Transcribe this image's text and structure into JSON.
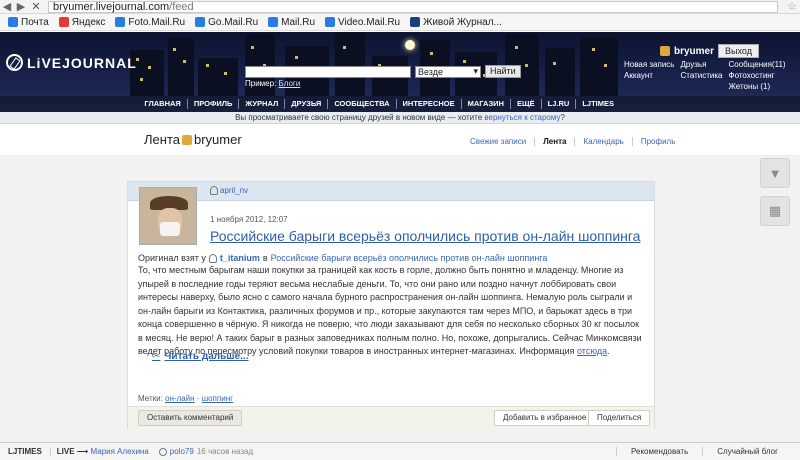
{
  "browser": {
    "url_host": "bryumer.livejournal.com",
    "url_path": "/feed",
    "bookmarks": [
      {
        "label": "Почта",
        "color": "#2a7be3"
      },
      {
        "label": "Яндекс",
        "color": "#e43a2f"
      },
      {
        "label": "Foto.Mail.Ru",
        "color": "#2a7be3"
      },
      {
        "label": "Go.Mail.Ru",
        "color": "#2a7be3"
      },
      {
        "label": "Mail.Ru",
        "color": "#2a7be3"
      },
      {
        "label": "Video.Mail.Ru",
        "color": "#2a7be3"
      },
      {
        "label": "Живой Журнал...",
        "color": "#1a3f7a"
      }
    ]
  },
  "header": {
    "logo_text": "LiVEJOURNAL",
    "search": {
      "scope": "Везде",
      "button": "Найти",
      "example_label": "Пример:",
      "example_link": "Блоги"
    },
    "user": {
      "name": "bryumer",
      "logout": "Выход"
    },
    "user_links": [
      "Новая запись",
      "Друзья",
      "Сообщения(11)",
      "Аккаунт",
      "Статистика",
      "Фотохостинг",
      "",
      "",
      "Жетоны (1)"
    ],
    "nav": [
      "ГЛАВНАЯ",
      "ПРОФИЛЬ",
      "ЖУРНАЛ",
      "ДРУЗЬЯ",
      "СООБЩЕСТВА",
      "ИНТЕРЕСНОЕ",
      "МАГАЗИН",
      "ЕЩЁ",
      "LJ.RU",
      "LJTIMES"
    ]
  },
  "notice": {
    "text": "Вы просматриваете свою страницу друзей в новом виде — хотите ",
    "link": "вернуться к старому",
    "end": "?"
  },
  "page": {
    "title_prefix": "Лента ",
    "title_user": "bryumer",
    "tabs": [
      "Свежие записи",
      "Лента",
      "Календарь",
      "Профиль"
    ]
  },
  "post": {
    "author": "april_nv",
    "date": "1 ноября 2012, 12:07",
    "title": "Российские барыги всерьёз ополчились против он-лайн шоппинга",
    "orig_prefix": "Оригинал взят у",
    "orig_user": "t_itanium",
    "orig_in": "в",
    "orig_link": "Российские барыги всерьёз ополчились против он-лайн шоппинга",
    "body": [
      "То, что местным барыгам наши покупки за границей как кость в горле, должно быть понятно и младенцу. Многие из",
      "упырей в последние годы теряют весьма неслабые деньги. То, что они рано или поздно начнут лоббировать свои",
      "интересы наверху, было ясно с самого начала бурного распространения он-лайн шоппинга. Немалую роль сыграли и",
      "он-лайн барыги из Контактика, различных форумов и пр., которые закупаются там через МПО, и барыжат здесь в три",
      "конца совершенно в чёрную. Я никогда не поверю, что люди заказывают для себя по несколько сборных 30 кг посылок",
      "в месяц. Не верю! А таких барыг в разных заповедниках полным полно. Но, похоже, допрыгались. Сейчас Минкомсвязи",
      "ведет работу по пересмотру условий покупки товаров в иностранных интернет-магазинах. Информация "
    ],
    "body_link": "отсюда",
    "body_end": ".",
    "read_more": "Читать дальше...",
    "tags_label": "Метки:",
    "tags": [
      "он-лайн",
      "шоппинг"
    ],
    "tags_sep": " · ",
    "buttons": {
      "comment": "Оставить комментарий",
      "favorite": "Добавить в избранное",
      "share": "Поделиться"
    }
  },
  "statusbar": {
    "logo": "LJTIMES",
    "live": "LIVE",
    "arrow": "⟶",
    "live_user": "Мария Алехина",
    "recent_user": "polo79",
    "recent_time": "16 часов назад",
    "right": [
      "Рекомендовать",
      "Случайный блог"
    ]
  }
}
